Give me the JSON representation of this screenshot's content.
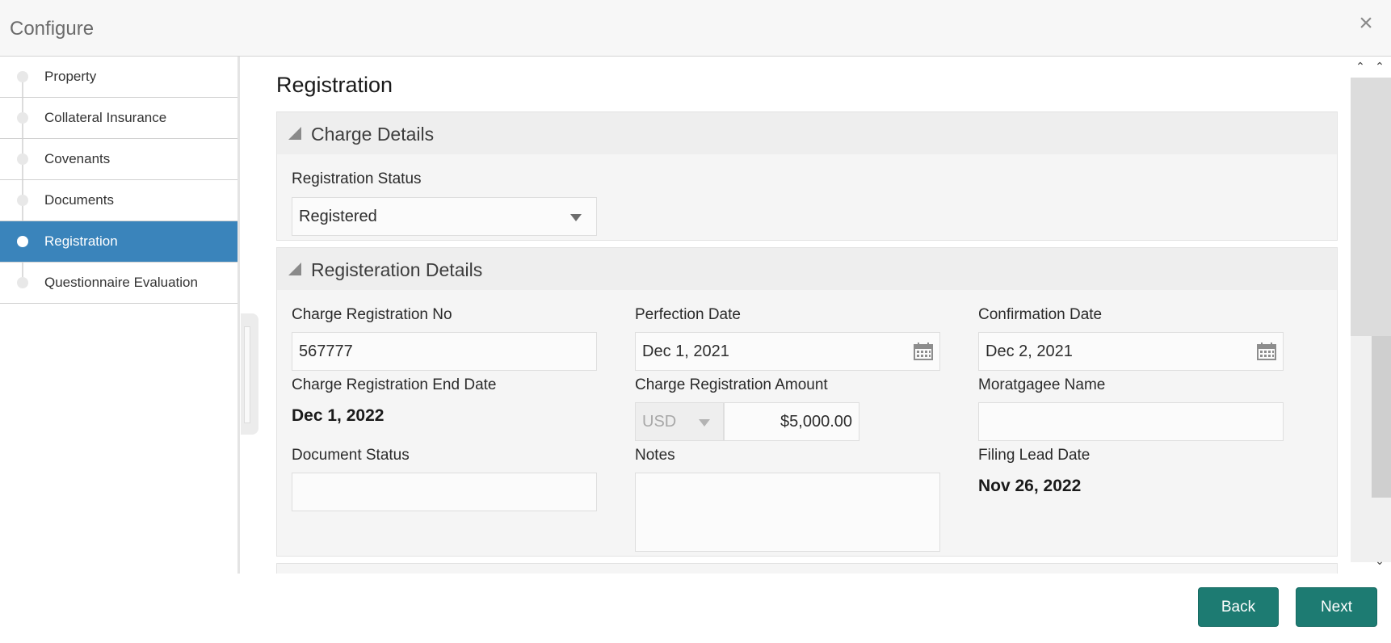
{
  "window": {
    "title": "Configure"
  },
  "sidebar": {
    "steps": [
      {
        "label": "Property"
      },
      {
        "label": "Collateral Insurance"
      },
      {
        "label": "Covenants"
      },
      {
        "label": "Documents"
      },
      {
        "label": "Registration",
        "active": true
      },
      {
        "label": "Questionnaire Evaluation"
      }
    ]
  },
  "main": {
    "page_title": "Registration",
    "charge_details": {
      "section_title": "Charge Details",
      "registration_status_label": "Registration Status",
      "registration_status_value": "Registered"
    },
    "registration_details": {
      "section_title": "Registeration Details",
      "charge_registration_no_label": "Charge Registration No",
      "charge_registration_no_value": "567777",
      "perfection_date_label": "Perfection Date",
      "perfection_date_value": "Dec 1, 2021",
      "confirmation_date_label": "Confirmation Date",
      "confirmation_date_value": "Dec 2, 2021",
      "charge_registration_end_date_label": "Charge Registration End Date",
      "charge_registration_end_date_value": "Dec 1, 2022",
      "charge_registration_amount_label": "Charge Registration Amount",
      "currency_value": "USD",
      "amount_value": "$5,000.00",
      "mortgagee_name_label": "Moratgagee Name",
      "mortgagee_name_value": "",
      "document_status_label": "Document Status",
      "document_status_value": "",
      "notes_label": "Notes",
      "notes_value": "",
      "filing_lead_date_label": "Filing Lead Date",
      "filing_lead_date_value": "Nov 26, 2022"
    }
  },
  "footer": {
    "back_label": "Back",
    "next_label": "Next"
  },
  "colors": {
    "accent_active": "#3a84bb",
    "button": "#1d7b72"
  },
  "icons": {
    "close": "close-icon",
    "calendar": "calendar-icon",
    "collapse": "triangle-collapse-icon"
  }
}
